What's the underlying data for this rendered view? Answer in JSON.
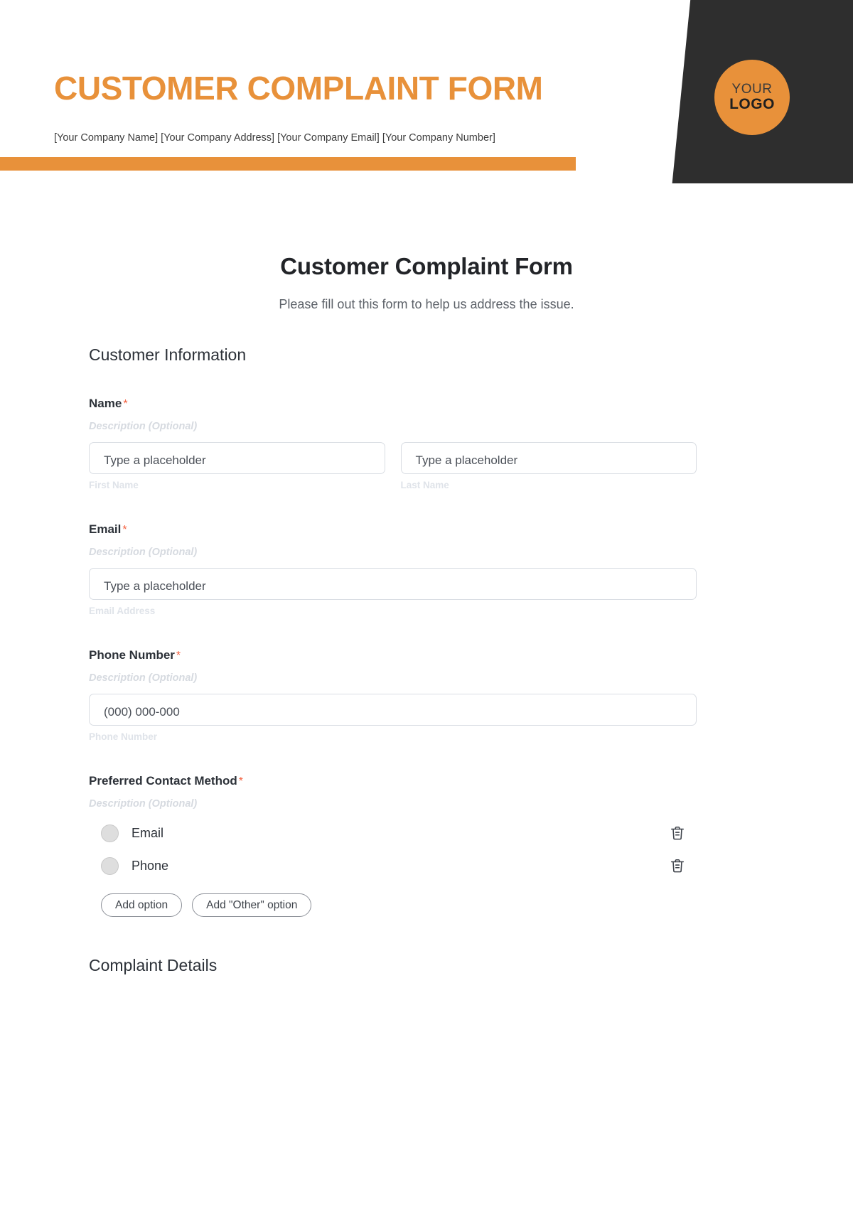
{
  "banner": {
    "title": "CUSTOMER COMPLAINT FORM",
    "contact_line": "[Your Company Name] [Your Company Address] [Your Company Email] [Your Company Number]",
    "logo_line1": "YOUR",
    "logo_line2": "LOGO",
    "accent_color": "#e8913a",
    "dark_color": "#2e2e2e"
  },
  "form": {
    "title": "Customer Complaint Form",
    "subtitle": "Please fill out this form to help us address the issue.",
    "sections": {
      "customer_information": "Customer Information",
      "complaint_details": "Complaint Details"
    },
    "description_placeholder": "Description (Optional)",
    "required_marker": "*",
    "fields": {
      "name": {
        "label": "Name",
        "description": "Description (Optional)",
        "first": {
          "placeholder": "Type a placeholder",
          "sublabel": "First Name"
        },
        "last": {
          "placeholder": "Type a placeholder",
          "sublabel": "Last Name"
        }
      },
      "email": {
        "label": "Email",
        "description": "Description (Optional)",
        "placeholder": "Type a placeholder",
        "sublabel": "Email Address"
      },
      "phone": {
        "label": "Phone Number",
        "description": "Description (Optional)",
        "placeholder": "(000) 000-000",
        "sublabel": "Phone Number"
      },
      "preferred_contact": {
        "label": "Preferred Contact Method",
        "description": "Description (Optional)",
        "options": [
          {
            "label": "Email"
          },
          {
            "label": "Phone"
          }
        ],
        "add_option_label": "Add option",
        "add_other_option_label": "Add \"Other\" option"
      }
    }
  }
}
